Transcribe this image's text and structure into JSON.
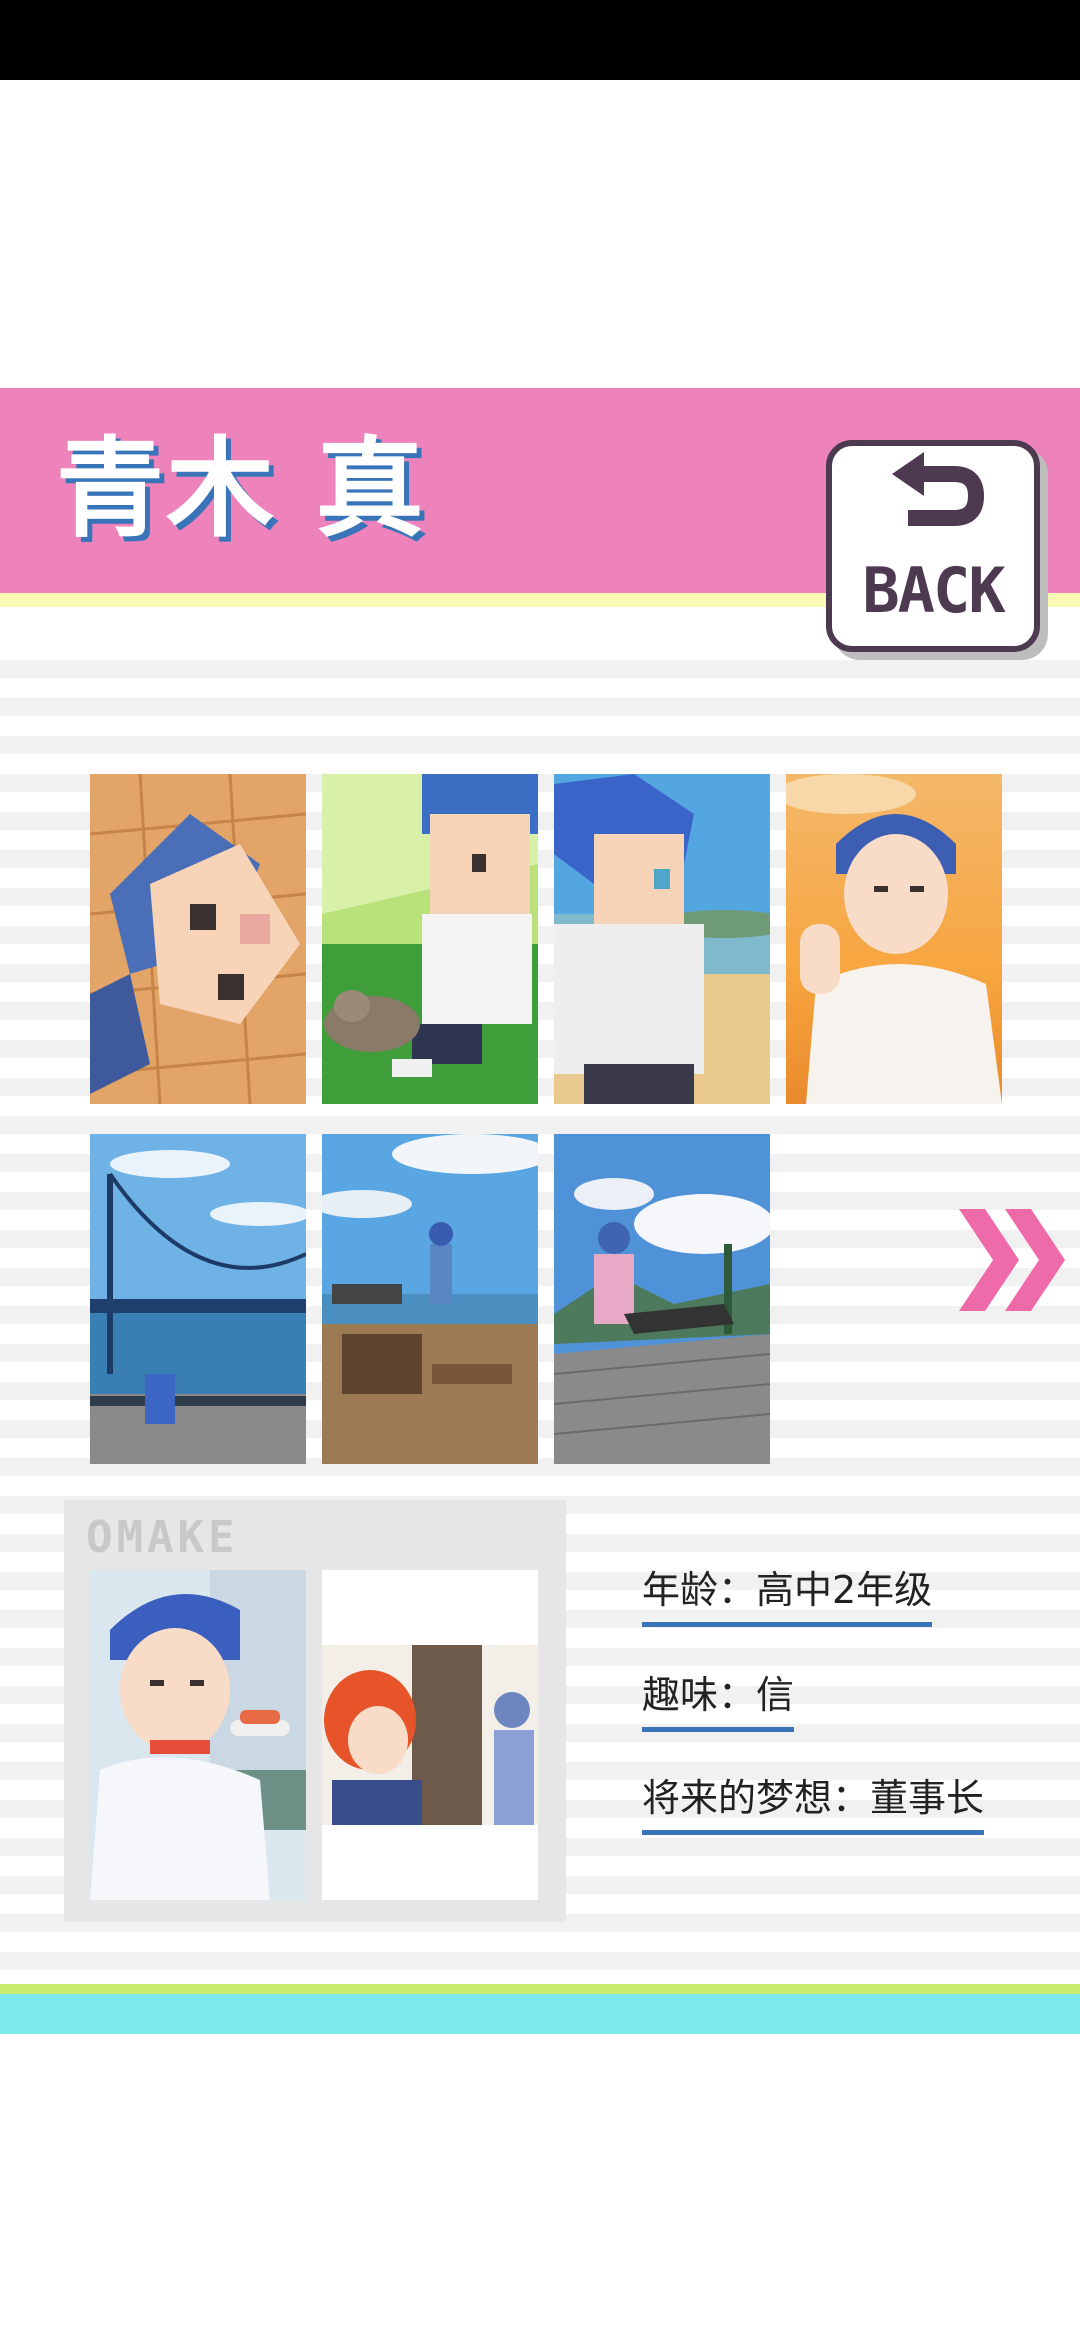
{
  "header": {
    "title": "青木 真"
  },
  "back_button": {
    "label": "BACK",
    "icon": "return-arrow-icon"
  },
  "gallery": {
    "items": [
      {
        "name": "pixel-face-closeup"
      },
      {
        "name": "pixel-boy-with-cat"
      },
      {
        "name": "pixel-boy-at-beach"
      },
      {
        "name": "anime-boy-sunset"
      },
      {
        "name": "bridge-photo"
      },
      {
        "name": "observation-deck-photo"
      },
      {
        "name": "boardwalk-photo"
      }
    ],
    "next_icon": "double-chevron-right-icon"
  },
  "omake": {
    "label": "OMAKE"
  },
  "profile": {
    "age": "年龄：高中2年级",
    "hobby": "趣味：信",
    "dream": "将来的梦想：董事长"
  },
  "colors": {
    "header_pink": "#ee82bb",
    "accent_blue": "#3a74b8",
    "footer_cyan": "#7eeaf0"
  }
}
